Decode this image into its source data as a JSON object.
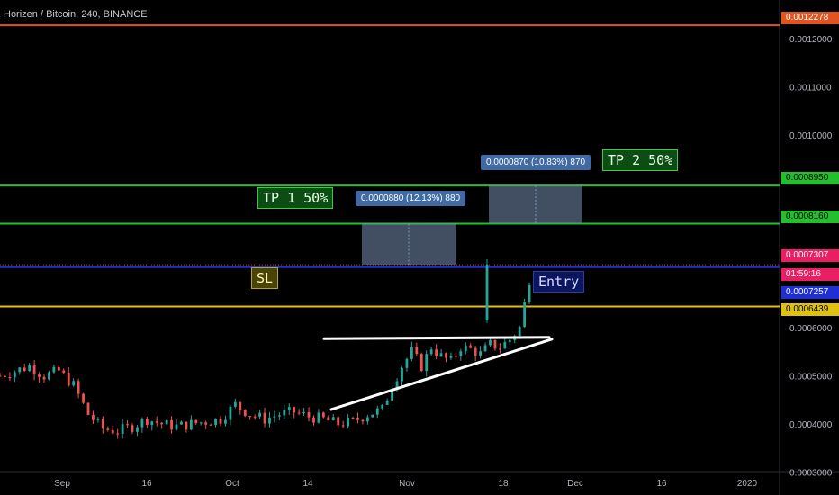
{
  "symbol_title": "Horizen / Bitcoin, 240, BINANCE",
  "countdown": "01:59:16",
  "colors": {
    "background": "#000000",
    "up": "#26a69a",
    "down": "#ef5350",
    "tp": "#22c02c",
    "sl": "#e0c20e",
    "entry": "#1f2fd6",
    "top": "#e2541d",
    "current": "#e91e63"
  },
  "annotations": {
    "tp1": "TP 1 50%",
    "tp2": "TP 2 50%",
    "sl": "SL",
    "entry": "Entry",
    "measure1": "0.0000880 (12.13%) 880",
    "measure2": "0.0000870 (10.83%) 870"
  },
  "price_labels": {
    "top": "0.0012278",
    "tp2": "0.0008950",
    "tp1": "0.0008160",
    "current": "0.0007307",
    "entry": "0.0007257",
    "sl": "0.0006439"
  },
  "chart_data": {
    "type": "candlestick",
    "title": "Horizen / Bitcoin, 240, BINANCE",
    "y_ticks": [
      "0.0012000",
      "0.0011000",
      "0.0010000",
      "0.0006000",
      "0.0005000",
      "0.0004000",
      "0.0003000"
    ],
    "x_ticks": [
      "Sep",
      "16",
      "Oct",
      "14",
      "Nov",
      "18",
      "Dec",
      "16",
      "2020"
    ],
    "ylim": [
      0.00029,
      0.00125
    ],
    "horizontal_levels": [
      {
        "name": "top",
        "value": 0.0012278
      },
      {
        "name": "tp2",
        "value": 0.000895
      },
      {
        "name": "tp1",
        "value": 0.000816
      },
      {
        "name": "current",
        "value": 0.0007307
      },
      {
        "name": "entry",
        "value": 0.0007257
      },
      {
        "name": "sl",
        "value": 0.0006439
      }
    ],
    "series_close_path": [
      [
        0,
        0.0005
      ],
      [
        3,
        0.00051
      ],
      [
        6,
        0.00052
      ],
      [
        9,
        0.0005
      ],
      [
        12,
        0.00051
      ],
      [
        15,
        0.00048
      ],
      [
        18,
        0.00042
      ],
      [
        21,
        0.00039
      ],
      [
        24,
        0.000385
      ],
      [
        27,
        0.000395
      ],
      [
        30,
        0.00041
      ],
      [
        33,
        0.0004
      ],
      [
        36,
        0.000395
      ],
      [
        39,
        0.0004
      ],
      [
        42,
        0.000405
      ],
      [
        45,
        0.00041
      ],
      [
        48,
        0.00044
      ],
      [
        51,
        0.00042
      ],
      [
        54,
        0.00041
      ],
      [
        57,
        0.00042
      ],
      [
        60,
        0.000425
      ],
      [
        63,
        0.000415
      ],
      [
        66,
        0.00041
      ],
      [
        69,
        0.0004
      ],
      [
        72,
        0.000405
      ],
      [
        75,
        0.00042
      ],
      [
        78,
        0.00043
      ],
      [
        80,
        0.00048
      ],
      [
        82,
        0.00052
      ],
      [
        84,
        0.00055
      ],
      [
        86,
        0.00052
      ],
      [
        88,
        0.00056
      ],
      [
        90,
        0.00054
      ],
      [
        92,
        0.00053
      ],
      [
        94,
        0.00056
      ],
      [
        96,
        0.000555
      ],
      [
        98,
        0.000545
      ],
      [
        100,
        0.000565
      ],
      [
        102,
        0.00056
      ],
      [
        104,
        0.000575
      ],
      [
        106,
        0.0006
      ],
      [
        107,
        0.00065
      ],
      [
        108,
        0.0007
      ],
      [
        109,
        0.00073
      ]
    ]
  }
}
